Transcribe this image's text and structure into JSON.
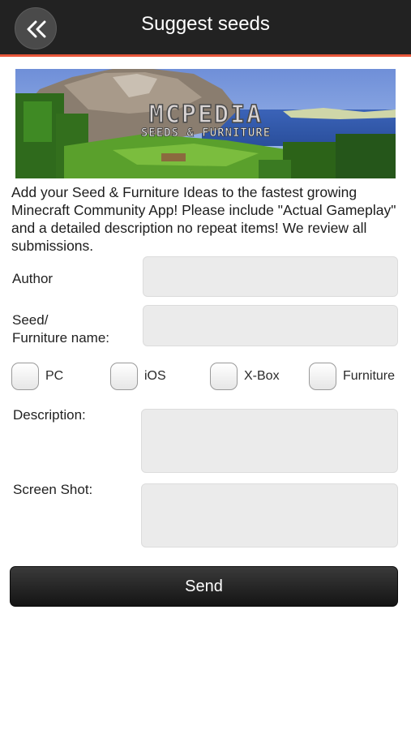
{
  "header": {
    "title": "Suggest seeds",
    "back_icon": "double-chevron-left-icon",
    "background": "#222222",
    "accent": "#e8563a"
  },
  "banner": {
    "logo_text": "MCPEDIA",
    "logo_subtitle": "SEEDS & FURNITURE"
  },
  "intro_text": "Add your Seed & Furniture Ideas to the fastest growing Minecraft Community App! Please include \"Actual Gameplay\" and a detailed description no repeat items! We review all submissions.",
  "form": {
    "author_label": "Author",
    "author_value": "",
    "seed_label_line1": "Seed/",
    "seed_label_line2": "Furniture name:",
    "seed_value": "",
    "platforms": [
      {
        "label": "PC",
        "checked": false
      },
      {
        "label": "iOS",
        "checked": false
      },
      {
        "label": "X-Box",
        "checked": false
      },
      {
        "label": "Furniture",
        "checked": false
      }
    ],
    "description_label": "Description:",
    "description_value": "",
    "screenshot_label": "Screen Shot:",
    "screenshot_value": "",
    "send_label": "Send"
  }
}
